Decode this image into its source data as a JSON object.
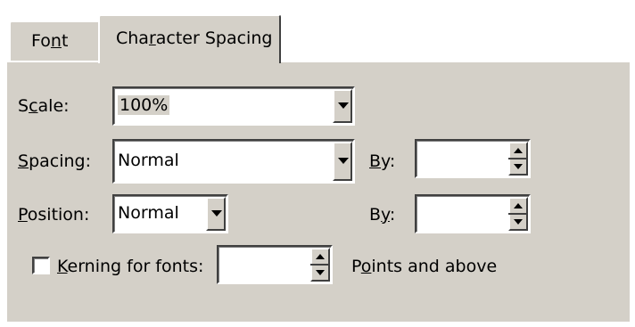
{
  "tabs": {
    "font": "Font",
    "character_spacing": "Character Spacing"
  },
  "scale": {
    "label": "Scale:",
    "value": "100%"
  },
  "spacing": {
    "label": "Spacing:",
    "value": "Normal",
    "by_label": "By:",
    "by_value": ""
  },
  "position": {
    "label": "Position:",
    "value": "Normal",
    "by_label": "By:",
    "by_value": ""
  },
  "kerning": {
    "label": "Kerning for fonts:",
    "checked": false,
    "value": "",
    "suffix": "Points and above"
  },
  "icons": [
    "dropdown-arrow-icon",
    "spin-up-icon",
    "spin-down-icon",
    "checkbox-icon"
  ]
}
